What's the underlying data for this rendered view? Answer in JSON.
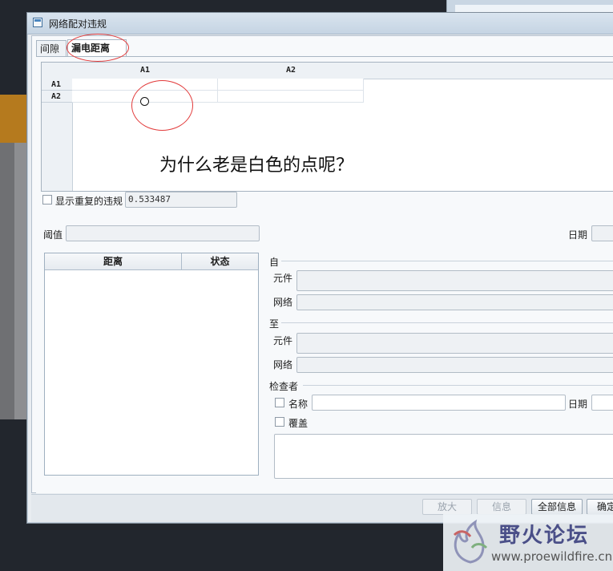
{
  "dialog": {
    "title": "网络配对违规",
    "tabs": [
      {
        "label": "间隙",
        "active": false
      },
      {
        "label": "漏电距离",
        "active": true
      }
    ]
  },
  "matrix": {
    "columns": [
      "A1",
      "A2"
    ],
    "rows": [
      "A1",
      "A2"
    ]
  },
  "annotation": {
    "question": "为什么老是白色的点呢？"
  },
  "options": {
    "show_duplicate_label": "显示重复的违规",
    "show_duplicate_value": "0.533487"
  },
  "threshold": {
    "label": "阈值",
    "value": ""
  },
  "date": {
    "label": "日期"
  },
  "list": {
    "columns": [
      "距离",
      "状态"
    ],
    "rows": []
  },
  "from": {
    "group": "自",
    "component_label": "元件",
    "net_label": "网络"
  },
  "to": {
    "group": "至",
    "component_label": "元件",
    "net_label": "网络"
  },
  "checker": {
    "group": "检查者",
    "name_label": "名称",
    "date_label": "日期",
    "override_label": "覆盖"
  },
  "buttons": {
    "zoom": "放大",
    "info": "信息",
    "all_info": "全部信息",
    "ok": "确定"
  },
  "watermark": {
    "title": "野火论坛",
    "url": "www.proewildfire.cn"
  },
  "colors": {
    "annotation_red": "#e23a3a",
    "watermark_purple": "#4a4f88"
  }
}
